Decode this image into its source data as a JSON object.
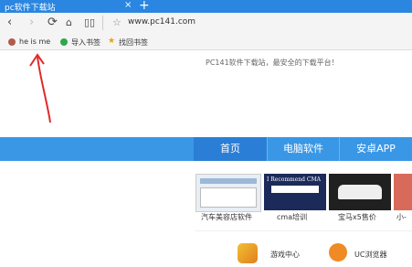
{
  "browser": {
    "tab_title": "pc软件下载站",
    "url": "www.pc141.com"
  },
  "bookmarks": [
    {
      "label": "he is me"
    },
    {
      "label": "导入书签"
    },
    {
      "label": "找回书签"
    }
  ],
  "page": {
    "slogan": "PC141软件下载站，最安全的下载平台！",
    "nav": [
      "首页",
      "电脑软件",
      "安卓APP"
    ],
    "cards": [
      {
        "caption": "汽车美容店软件"
      },
      {
        "caption": "cma培训"
      },
      {
        "caption": "宝马x5售价"
      },
      {
        "caption": "小-"
      }
    ],
    "bottom": {
      "caption": "游戏中心",
      "badge": "UC浏览器"
    }
  },
  "colors": {
    "accent": "#2a86e0",
    "nav_active": "#2a7ed6",
    "arrow": "#e02b2b"
  }
}
